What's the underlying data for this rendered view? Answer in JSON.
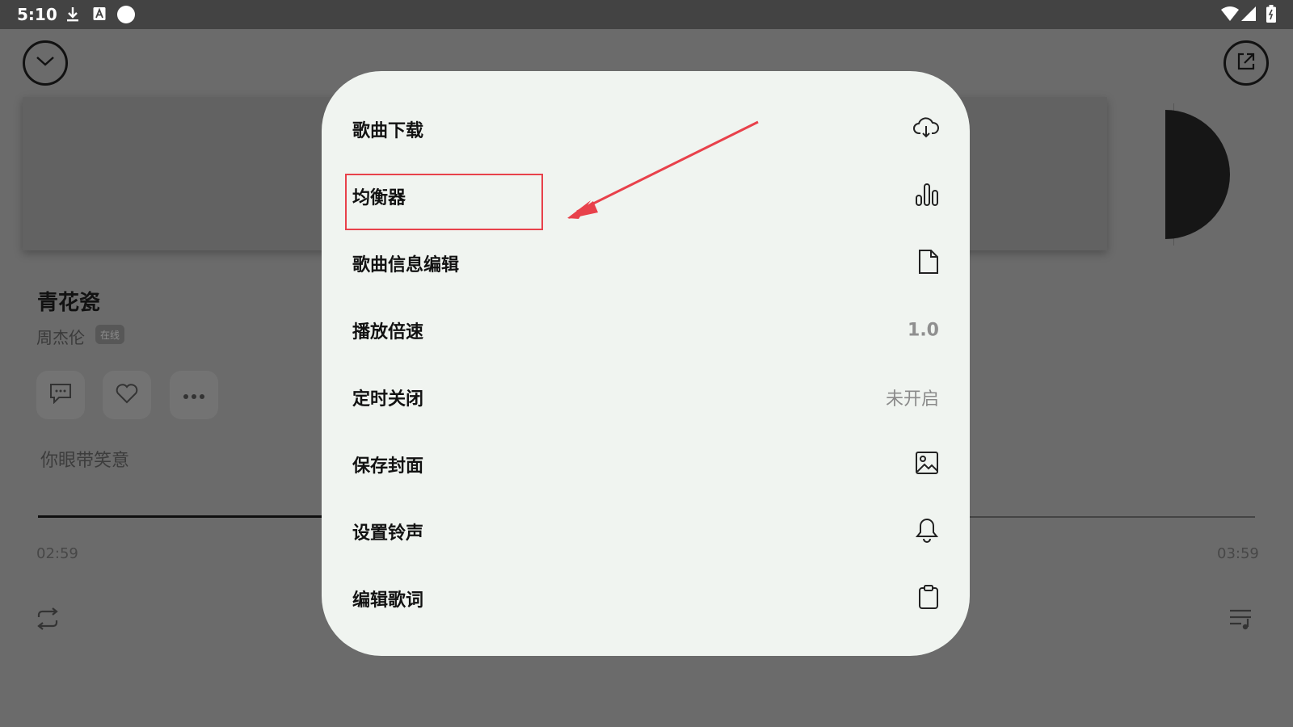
{
  "status_bar": {
    "time": "5:10",
    "icons": [
      "download-icon",
      "text-icon",
      "dot-icon",
      "wifi-icon",
      "signal-icon",
      "battery-icon"
    ]
  },
  "player": {
    "collapse_icon": "chevron-down-icon",
    "share_icon": "share-icon",
    "song_title": "青花瓷",
    "artist": "周杰伦",
    "source_tag": "在线",
    "actions": [
      "comment-icon",
      "heart-icon",
      "more-icon"
    ],
    "lyric_line": "你眼带笑意",
    "current_time": "02:59",
    "total_time": "03:59",
    "progress_fraction": 0.75,
    "repeat_icon": "repeat-icon",
    "queue_icon": "queue-icon"
  },
  "menu": {
    "items": [
      {
        "label": "歌曲下载",
        "icon": "cloud-download-icon"
      },
      {
        "label": "均衡器",
        "icon": "equalizer-icon"
      },
      {
        "label": "歌曲信息编辑",
        "icon": "document-icon"
      },
      {
        "label": "播放倍速",
        "value": "1.0"
      },
      {
        "label": "定时关闭",
        "value": "未开启"
      },
      {
        "label": "保存封面",
        "icon": "image-icon"
      },
      {
        "label": "设置铃声",
        "icon": "bell-icon"
      },
      {
        "label": "编辑歌词",
        "icon": "clipboard-icon"
      }
    ]
  },
  "annotation": {
    "highlight_color": "#e8414b",
    "target": "均衡器"
  }
}
